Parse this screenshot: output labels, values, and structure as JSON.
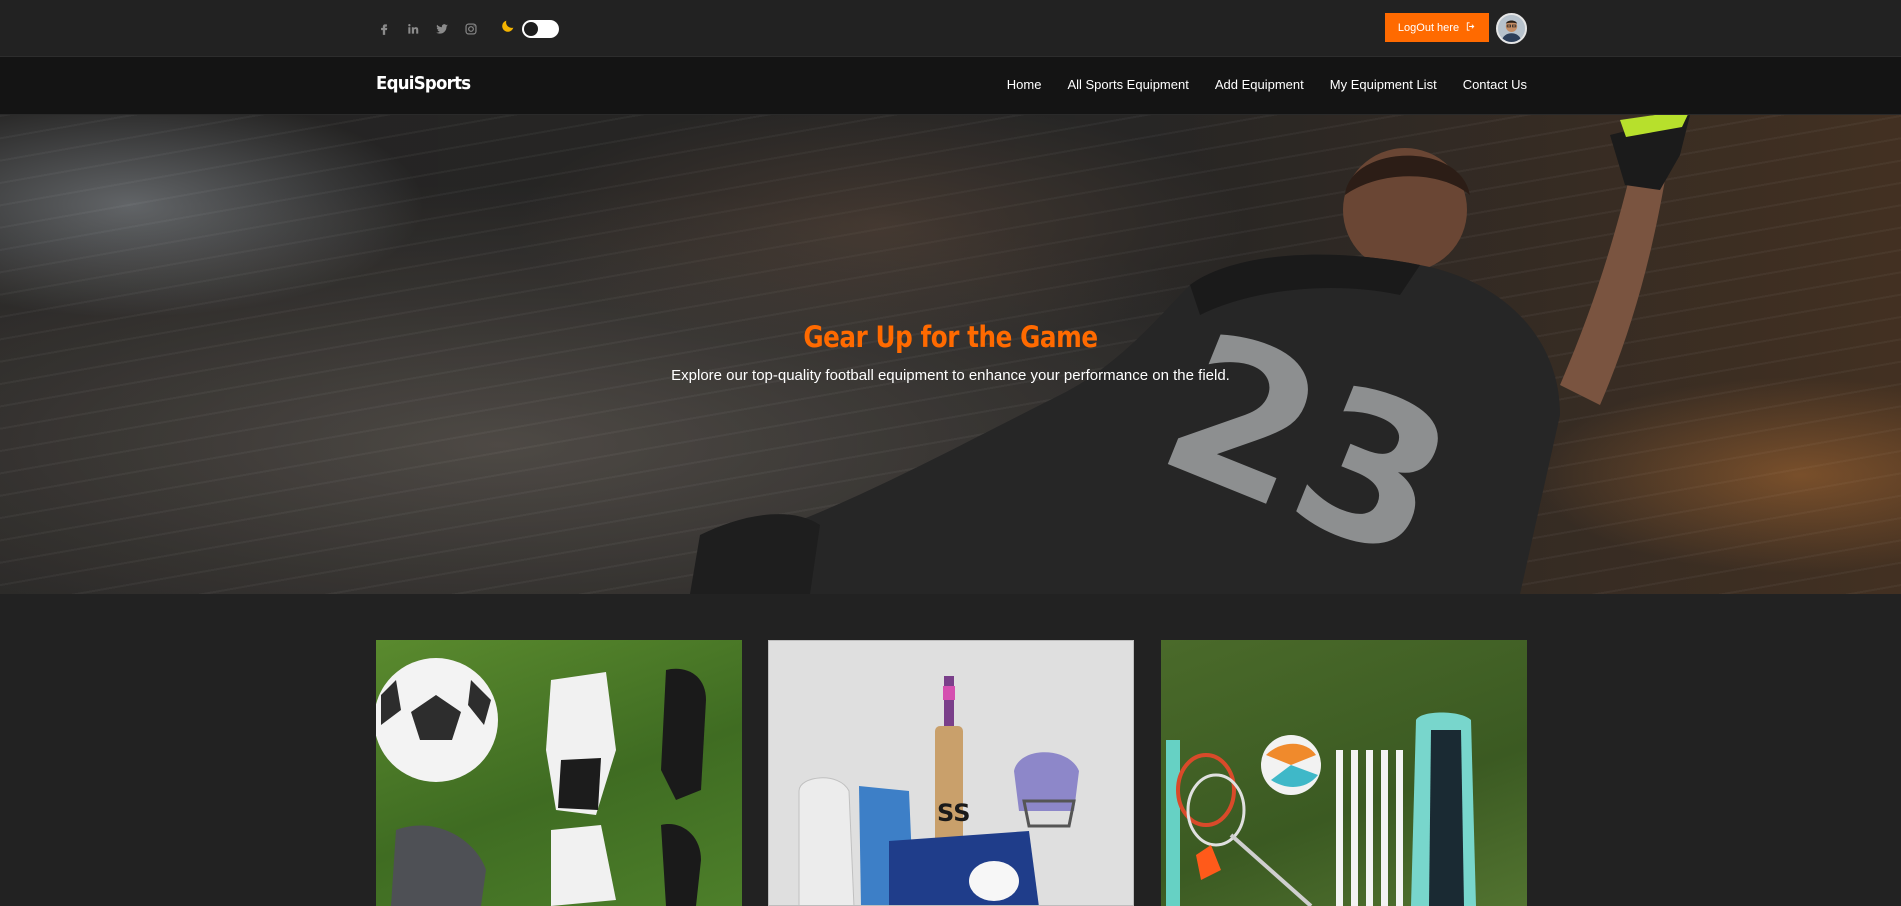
{
  "topbar": {
    "social_icons": [
      "facebook-icon",
      "linkedin-icon",
      "twitter-icon",
      "instagram-icon"
    ],
    "theme_icon": "moon-icon",
    "logout_label": "LogOut here",
    "logout_icon": "logout-icon"
  },
  "navbar": {
    "brand": "EquiSports",
    "items": [
      "Home",
      "All Sports Equipment",
      "Add Equipment",
      "My Equipment List",
      "Contact Us"
    ]
  },
  "hero": {
    "title": "Gear Up for the Game",
    "subtitle": "Explore our top-quality football equipment to enhance your performance on the field."
  },
  "cards": [
    {
      "image": "football-equipment-image"
    },
    {
      "image": "cricket-equipment-image"
    },
    {
      "image": "badminton-volleyball-set-image"
    }
  ],
  "colors": {
    "accent": "#ff6a00",
    "background": "#222222",
    "navbar": "#141414"
  }
}
